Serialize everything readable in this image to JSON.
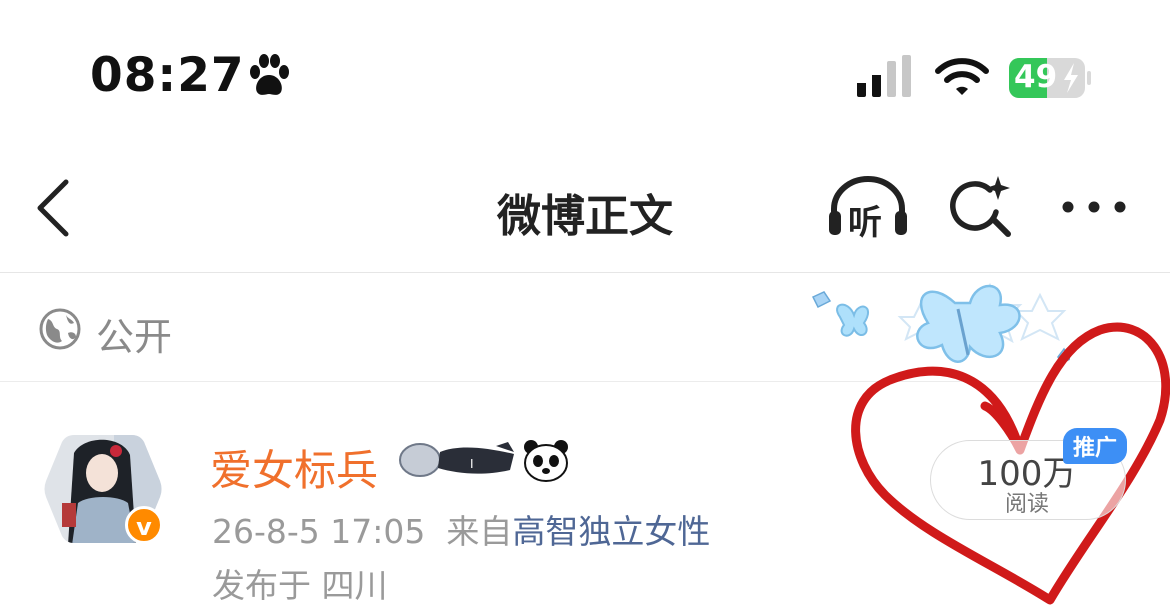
{
  "status_bar": {
    "time": "08:27",
    "battery_level": "49",
    "icons": [
      "paw-icon",
      "cellular-signal-icon",
      "wifi-icon",
      "battery-charging-icon"
    ]
  },
  "nav": {
    "title": "微博正文",
    "listen_label": "听",
    "icons": [
      "back-chevron-icon",
      "headphones-icon",
      "sparkle-search-icon",
      "more-dots-icon"
    ]
  },
  "visibility": {
    "label": "公开",
    "icon": "globe-icon"
  },
  "post": {
    "author_name": "爱女标兵",
    "verified_badge": "v",
    "time": "26-8-5 17:05",
    "source_prefix": "来自",
    "source": "高智独立女性",
    "location": "发布于 四川",
    "reads_count": "100万",
    "reads_label": "阅读",
    "promo_tag": "推广"
  },
  "colors": {
    "name": "#f0702c",
    "source_link": "#4f6795",
    "battery_green": "#34c759",
    "promo_blue": "#3d8ff5",
    "heart_red": "#d01a1a"
  }
}
